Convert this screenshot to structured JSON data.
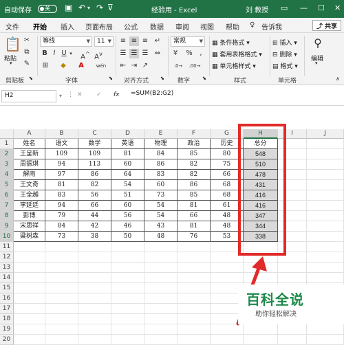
{
  "title_bar": {
    "autosave_label": "自动保存",
    "toggle_state": "关",
    "doc_title": "经验用 - Excel",
    "user_name": "刘 教授"
  },
  "tabs": [
    {
      "label": "文件"
    },
    {
      "label": "开始",
      "active": true
    },
    {
      "label": "插入"
    },
    {
      "label": "页面布局"
    },
    {
      "label": "公式"
    },
    {
      "label": "数据"
    },
    {
      "label": "审阅"
    },
    {
      "label": "视图"
    },
    {
      "label": "帮助"
    },
    {
      "label": "告诉我"
    }
  ],
  "share_label": "共享",
  "ribbon": {
    "clipboard": {
      "group_label": "剪贴板",
      "paste_label": "粘贴"
    },
    "font": {
      "group_label": "字体",
      "font_name": "等线",
      "font_size": "11"
    },
    "alignment": {
      "group_label": "对齐方式"
    },
    "number": {
      "group_label": "数字",
      "format": "常规"
    },
    "styles": {
      "group_label": "样式",
      "conditional": "条件格式",
      "table": "套用表格格式",
      "cell": "单元格样式"
    },
    "cells": {
      "group_label": "单元格",
      "insert": "插入",
      "delete": "删除",
      "format": "格式"
    },
    "editing": {
      "label": "编辑"
    }
  },
  "formula_bar": {
    "name_box": "H2",
    "cancel": "✕",
    "enter": "✓",
    "fx": "fx",
    "formula": "=SUM(B2:G2)"
  },
  "columns": [
    "A",
    "B",
    "C",
    "D",
    "E",
    "F",
    "G",
    "H",
    "I",
    "J"
  ],
  "rows": [
    "1",
    "2",
    "3",
    "4",
    "5",
    "6",
    "7",
    "8",
    "9",
    "10",
    "11",
    "12",
    "13",
    "14",
    "15",
    "16",
    "17",
    "18",
    "19",
    "20"
  ],
  "table": {
    "headers": [
      "姓名",
      "语文",
      "数学",
      "英语",
      "物理",
      "政治",
      "历史",
      "总分"
    ],
    "rows": [
      [
        "王呈新",
        "109",
        "109",
        "81",
        "84",
        "85",
        "80",
        "548"
      ],
      [
        "周振琪",
        "94",
        "113",
        "60",
        "86",
        "82",
        "75",
        "510"
      ],
      [
        "解雨",
        "97",
        "86",
        "64",
        "83",
        "82",
        "66",
        "478"
      ],
      [
        "王文奇",
        "81",
        "82",
        "54",
        "60",
        "86",
        "68",
        "431"
      ],
      [
        "王全越",
        "83",
        "56",
        "51",
        "73",
        "85",
        "68",
        "416"
      ],
      [
        "李延廷",
        "94",
        "66",
        "60",
        "54",
        "81",
        "61",
        "416"
      ],
      [
        "彭博",
        "79",
        "44",
        "56",
        "54",
        "66",
        "48",
        "347"
      ],
      [
        "宋思祥",
        "84",
        "42",
        "46",
        "43",
        "81",
        "48",
        "344"
      ],
      [
        "粱树森",
        "73",
        "38",
        "50",
        "48",
        "76",
        "53",
        "338"
      ]
    ]
  },
  "watermark": {
    "brand": "百科全说",
    "tagline": "助你轻松解决"
  },
  "colors": {
    "excel_green": "#217346",
    "highlight_red": "#e12a2a",
    "brand_green": "#1c8a4a"
  }
}
